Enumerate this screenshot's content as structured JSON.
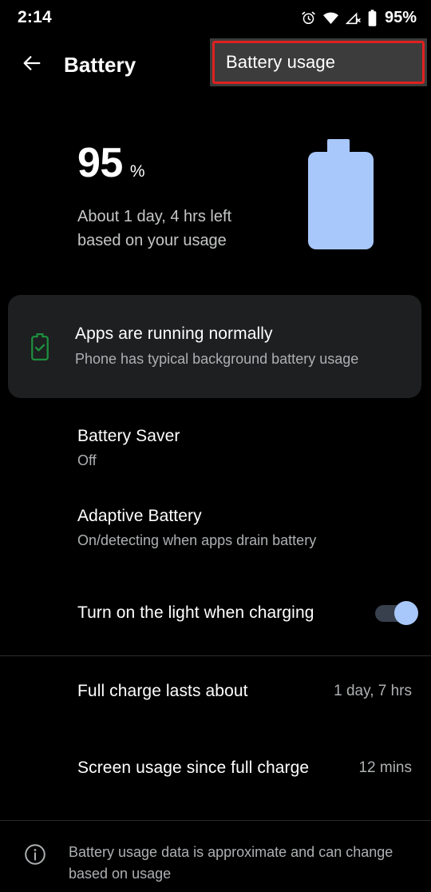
{
  "status_bar": {
    "clock": "2:14",
    "battery_percent_label": "95%",
    "icons": [
      "alarm-icon",
      "wifi-icon",
      "cellular-no-signal-icon",
      "battery-icon"
    ]
  },
  "app_bar": {
    "back_icon": "back-arrow-icon",
    "title": "Battery",
    "usage_button_label": "Battery usage",
    "highlight_color": "#e02020",
    "usage_button_bg": "#3c3c3c"
  },
  "hero": {
    "percent_value": "95",
    "percent_sign": "%",
    "estimate_line1": "About 1 day, 4 hrs left",
    "estimate_line2": "based on your usage",
    "battery_graphic_icon": "battery-full-icon",
    "battery_graphic_color": "#a8c7fa"
  },
  "status_card": {
    "icon": "battery-check-icon",
    "icon_color": "#1e8e3e",
    "title": "Apps are running normally",
    "description": "Phone has typical background battery usage"
  },
  "settings_rows": [
    {
      "name": "battery-saver",
      "title": "Battery Saver",
      "subtitle": "Off"
    },
    {
      "name": "adaptive-battery",
      "title": "Adaptive Battery",
      "subtitle": "On/detecting when apps drain battery"
    },
    {
      "name": "light-when-charging",
      "title": "Turn on the light when charging",
      "toggle_on": true
    }
  ],
  "info_rows": [
    {
      "name": "full-charge-lasts-about",
      "title": "Full charge lasts about",
      "value": "1 day, 7 hrs"
    },
    {
      "name": "screen-usage-since-full-charge",
      "title": "Screen usage since full charge",
      "value": "12 mins"
    }
  ],
  "footer": {
    "icon": "info-icon",
    "text": "Battery usage data is approximate and can change based on usage"
  }
}
